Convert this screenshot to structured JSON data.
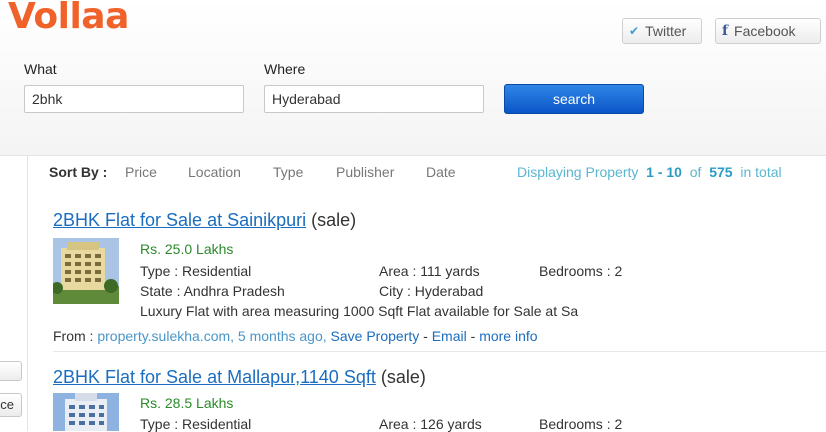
{
  "header": {
    "logo": "Vollaa",
    "twitter_label": "Twitter",
    "facebook_label": "Facebook"
  },
  "search": {
    "what_label": "What",
    "what_value": "2bhk",
    "where_label": "Where",
    "where_value": "Hyderabad",
    "button_label": "search"
  },
  "sort": {
    "label": "Sort By :",
    "options": [
      "Price",
      "Location",
      "Type",
      "Publisher",
      "Date"
    ]
  },
  "results_info": {
    "prefix": "Displaying Property",
    "range": "1 - 10",
    "of": "of",
    "total": "575",
    "suffix": "in total"
  },
  "left_panel": {
    "button_partial": "ce"
  },
  "listings": [
    {
      "title": "2BHK Flat for Sale at Sainikpuri",
      "kind": "(sale)",
      "price": "Rs. 25.0 Lakhs",
      "type": "Type : Residential",
      "area": "Area : 111 yards",
      "bedrooms": "Bedrooms : 2",
      "state": "State : Andhra Pradesh",
      "city": "City : Hyderabad",
      "description": "Luxury Flat with area measuring 1000 Sqft Flat available for Sale at Sa",
      "from_label": "From :",
      "source": "property.sulekha.com, 5 months ago,",
      "save": "Save Property",
      "dash1": "-",
      "email": "Email",
      "dash2": "-",
      "more": "more info"
    },
    {
      "title": "2BHK Flat for Sale at Mallapur,1140 Sqft",
      "kind": "(sale)",
      "price": "Rs. 28.5 Lakhs",
      "type": "Type : Residential",
      "area": "Area : 126 yards",
      "bedrooms": "Bedrooms : 2"
    }
  ],
  "colors": {
    "logo": "#f0622a",
    "link": "#1a6dc0",
    "price": "#2a8a2a",
    "accent": "#2a9cc4",
    "button": "#1565d8"
  }
}
